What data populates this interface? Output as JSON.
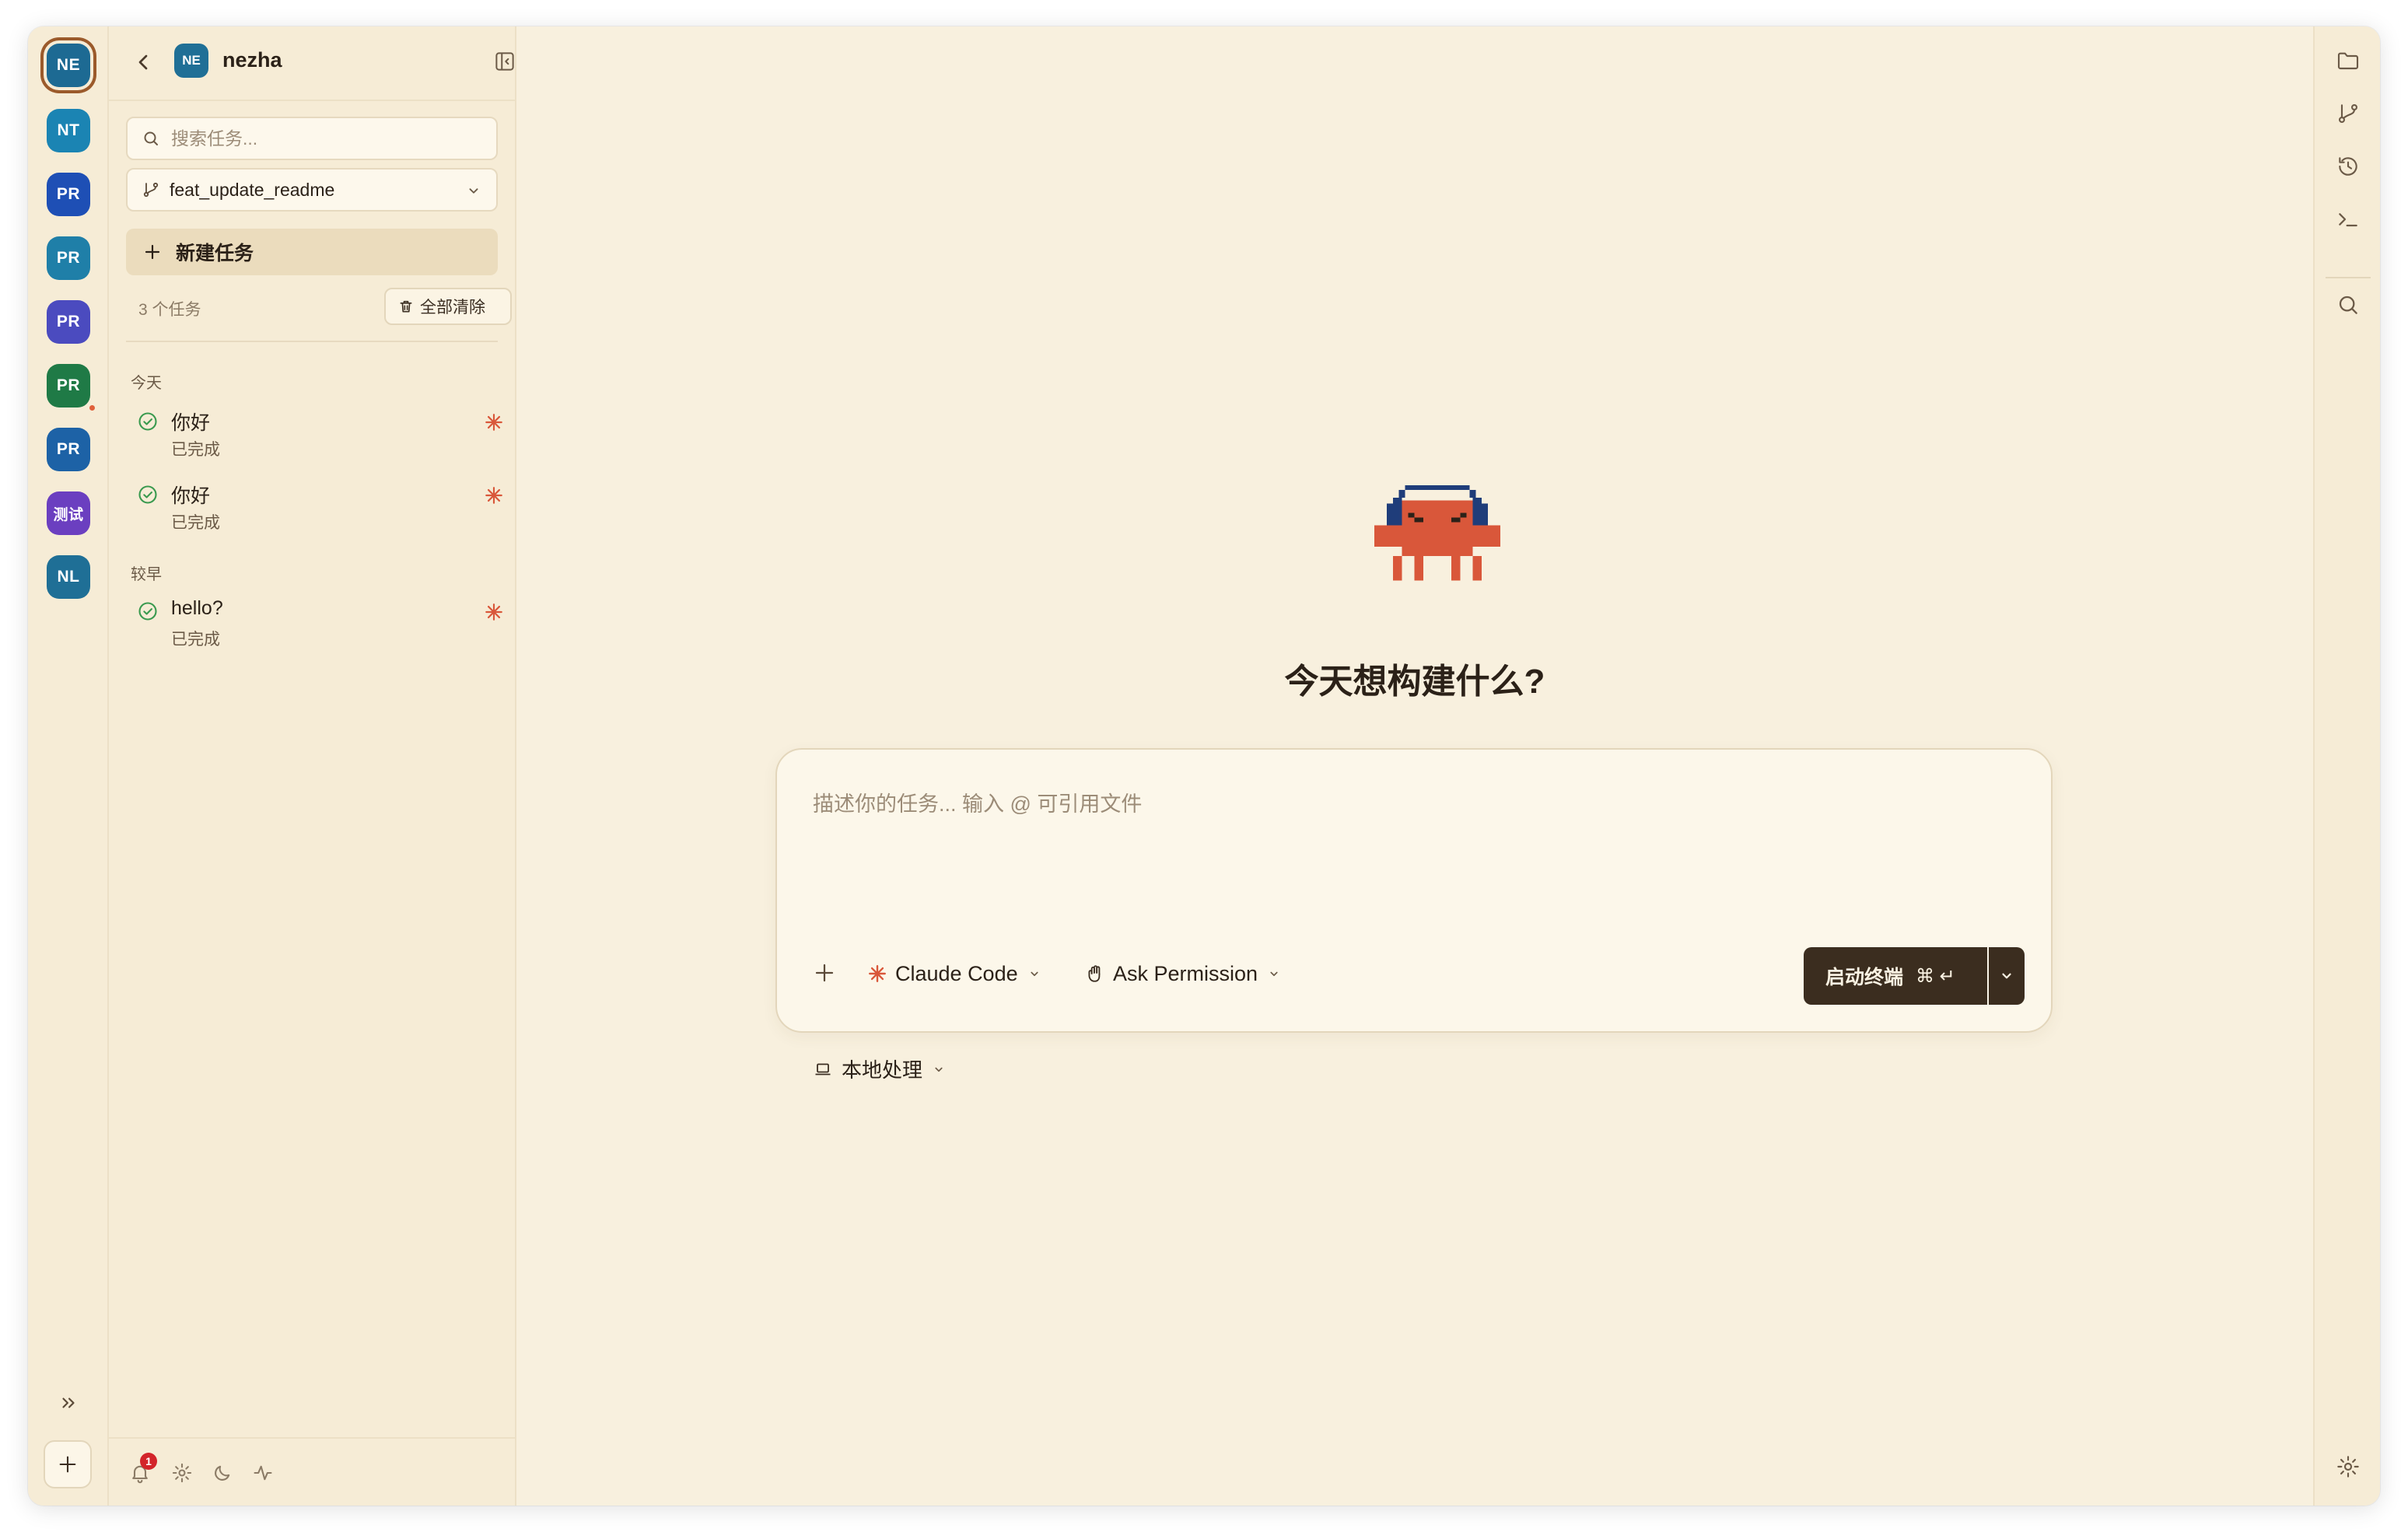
{
  "workspaces": [
    {
      "label": "NE",
      "color": "#1d6a93",
      "active": true
    },
    {
      "label": "NT",
      "color": "#1b84b3"
    },
    {
      "label": "PR",
      "color": "#1e4fb5"
    },
    {
      "label": "PR",
      "color": "#1f7fa8"
    },
    {
      "label": "PR",
      "color": "#4b4bbf"
    },
    {
      "label": "PR",
      "color": "#1f7a46",
      "dot": true
    },
    {
      "label": "PR",
      "color": "#1d62a6"
    },
    {
      "label": "测试",
      "color": "#6b3fc0"
    },
    {
      "label": "NL",
      "color": "#1f6f96"
    }
  ],
  "sidebar": {
    "project_avatar": "NE",
    "project_name": "nezha",
    "search_placeholder": "搜索任务...",
    "branch": "feat_update_readme",
    "new_task_label": "新建任务",
    "task_count": "3 个任务",
    "clear_all_label": "全部清除",
    "groups": [
      {
        "label": "今天",
        "tasks": [
          {
            "title": "你好",
            "status": "已完成"
          },
          {
            "title": "你好",
            "status": "已完成"
          }
        ]
      },
      {
        "label": "较早",
        "tasks": [
          {
            "title": "hello?",
            "status": "已完成"
          }
        ]
      }
    ],
    "notification_count": "1"
  },
  "main": {
    "headline": "今天想构建什么?",
    "composer": {
      "placeholder": "描述你的任务... 输入 @ 可引用文件",
      "agent_label": "Claude Code",
      "permission_label": "Ask Permission",
      "launch_label": "启动终端",
      "launch_shortcut": "⌘ ↵"
    },
    "location_label": "本地处理"
  },
  "colors": {
    "background": "#f8f0de",
    "sidebar": "#f6ecd6",
    "primary_button": "#3b2d1f",
    "accent": "#d9573a",
    "success": "#3a9a4f"
  }
}
